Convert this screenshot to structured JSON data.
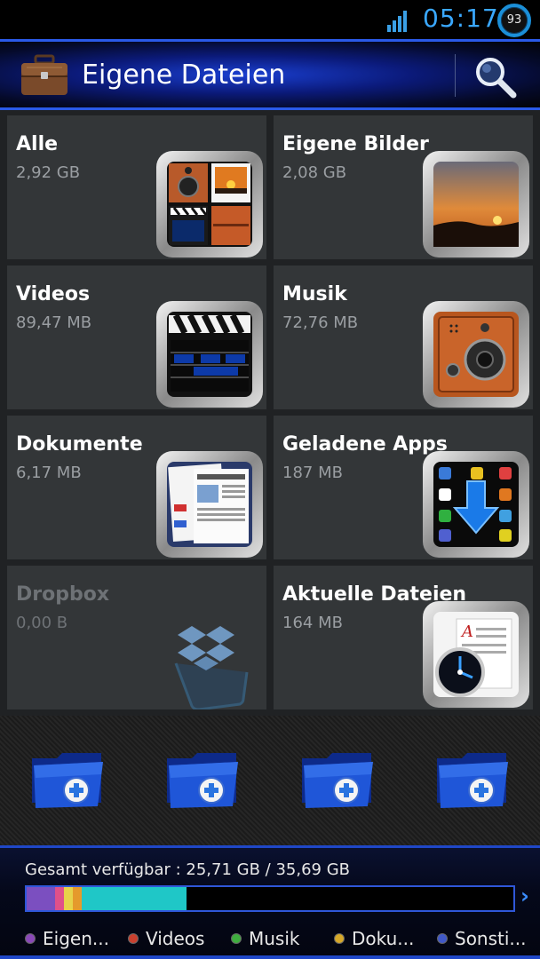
{
  "status_bar": {
    "time": "05:17",
    "battery": "93",
    "signal_icon": "signal-bars-icon"
  },
  "action_bar": {
    "title": "Eigene Dateien",
    "app_icon": "briefcase-icon",
    "search_icon": "search-icon"
  },
  "categories": [
    {
      "title": "Alle",
      "size": "2,92 GB",
      "icon": "all-files-collage-icon"
    },
    {
      "title": "Eigene Bilder",
      "size": "2,08 GB",
      "icon": "sunset-image-icon"
    },
    {
      "title": "Videos",
      "size": "89,47 MB",
      "icon": "clapperboard-icon"
    },
    {
      "title": "Musik",
      "size": "72,76 MB",
      "icon": "speaker-icon"
    },
    {
      "title": "Dokumente",
      "size": "6,17 MB",
      "icon": "newspaper-icon"
    },
    {
      "title": "Geladene Apps",
      "size": "187 MB",
      "icon": "apps-download-icon"
    },
    {
      "title": "Dropbox",
      "size": "0,00 B",
      "icon": "dropbox-icon"
    },
    {
      "title": "Aktuelle Dateien",
      "size": "164 MB",
      "icon": "recent-document-clock-icon"
    }
  ],
  "shortcut_folders": [
    {
      "icon": "add-folder-icon"
    },
    {
      "icon": "add-folder-icon"
    },
    {
      "icon": "add-folder-icon"
    },
    {
      "icon": "add-folder-icon"
    }
  ],
  "storage": {
    "label": "Gesamt verfügbar : 25,71 GB / 35,69 GB",
    "segments": [
      {
        "name": "Eigene Bilder",
        "color": "#7b4fc0"
      },
      {
        "name": "Videos",
        "color": "#e0508a"
      },
      {
        "name": "Musik",
        "color": "#e7d24a"
      },
      {
        "name": "Dokumente",
        "color": "#e59a2c"
      },
      {
        "name": "Sonstige",
        "color": "#1fc7c7"
      }
    ],
    "legend": [
      {
        "label": "Eigen...",
        "color": "#8a48b8"
      },
      {
        "label": "Videos",
        "color": "#c9402f"
      },
      {
        "label": "Musik",
        "color": "#3fae3f"
      },
      {
        "label": "Doku...",
        "color": "#d6a829"
      },
      {
        "label": "Sonsti...",
        "color": "#4058c8"
      }
    ]
  }
}
